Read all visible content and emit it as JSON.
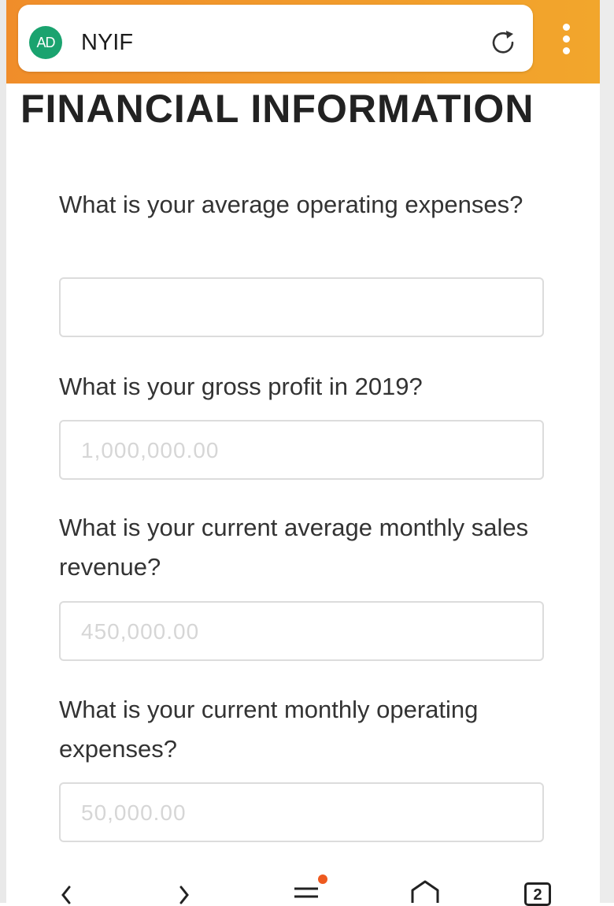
{
  "browser": {
    "ad_badge": "AD",
    "site_title": "NYIF",
    "reload_icon": "reload-icon",
    "menu_icon": "more-vert-icon",
    "accent_color": "#f2a62c",
    "badge_color": "#1aa36f"
  },
  "page": {
    "section_title": "FINANCIAL INFORMATION"
  },
  "form": {
    "questions": [
      {
        "label": "What is your average operating expenses?",
        "placeholder": ""
      },
      {
        "label": "What is your gross profit in 2019?",
        "placeholder": "1,000,000.00"
      },
      {
        "label": "What is your current average monthly sales revenue?",
        "placeholder": "450,000.00"
      },
      {
        "label": "What is your current monthly operating expenses?",
        "placeholder": "50,000.00"
      }
    ]
  },
  "bottom_nav": {
    "tab_count": "2",
    "items": [
      "back-icon",
      "forward-icon",
      "menu-icon",
      "home-icon",
      "tabs-icon"
    ]
  }
}
